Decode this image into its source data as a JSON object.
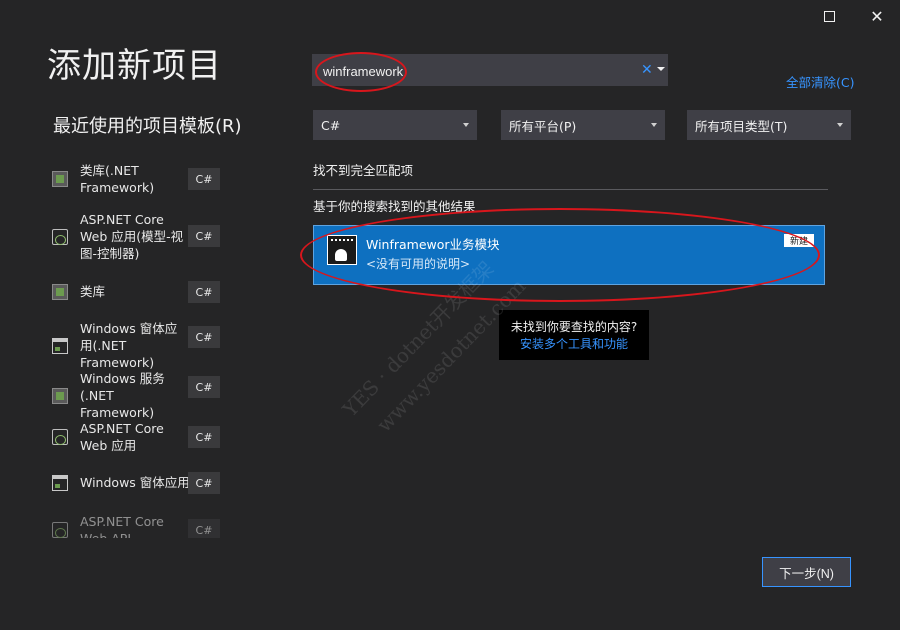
{
  "dialog": {
    "title": "添加新项目",
    "recent_heading": "最近使用的项目模板(R)",
    "clear_all": "全部清除(C)",
    "next_label": "下一步(N)"
  },
  "search": {
    "value": "winframework",
    "placeholder": ""
  },
  "filters": {
    "language": "C#",
    "platform": "所有平台(P)",
    "project_type": "所有项目类型(T)"
  },
  "results": {
    "no_match": "找不到完全匹配项",
    "other_results": "基于你的搜索找到的其他结果",
    "items": [
      {
        "name": "Winframewor业务模块",
        "description": "<没有可用的说明>",
        "badge": "新建",
        "icon": "template-icon"
      }
    ]
  },
  "help": {
    "question": "未找到你要查找的内容?",
    "link": "安装多个工具和功能"
  },
  "recent_templates": [
    {
      "label": "类库(.NET Framework)",
      "lang": "C#",
      "icon": "class-library-icon"
    },
    {
      "label": "ASP.NET Core Web 应用(模型-视图-控制器)",
      "lang": "C#",
      "icon": "web-app-icon"
    },
    {
      "label": "类库",
      "lang": "C#",
      "icon": "class-library-icon"
    },
    {
      "label": "Windows 窗体应用(.NET Framework)",
      "lang": "C#",
      "icon": "windows-form-icon"
    },
    {
      "label": "Windows 服务(.NET Framework)",
      "lang": "C#",
      "icon": "windows-service-icon"
    },
    {
      "label": "ASP.NET Core Web 应用",
      "lang": "C#",
      "icon": "web-app-icon"
    },
    {
      "label": "Windows 窗体应用",
      "lang": "C#",
      "icon": "windows-form-icon"
    },
    {
      "label": "ASP.NET Core Web API",
      "lang": "C#",
      "icon": "web-api-icon"
    }
  ],
  "watermark": [
    "YES · dotnet开发框架",
    "www.yesdotnet.com"
  ],
  "colors": {
    "background": "#252526",
    "accent": "#3794ff",
    "selected": "#0e70c0",
    "annotation": "#d8161c"
  }
}
